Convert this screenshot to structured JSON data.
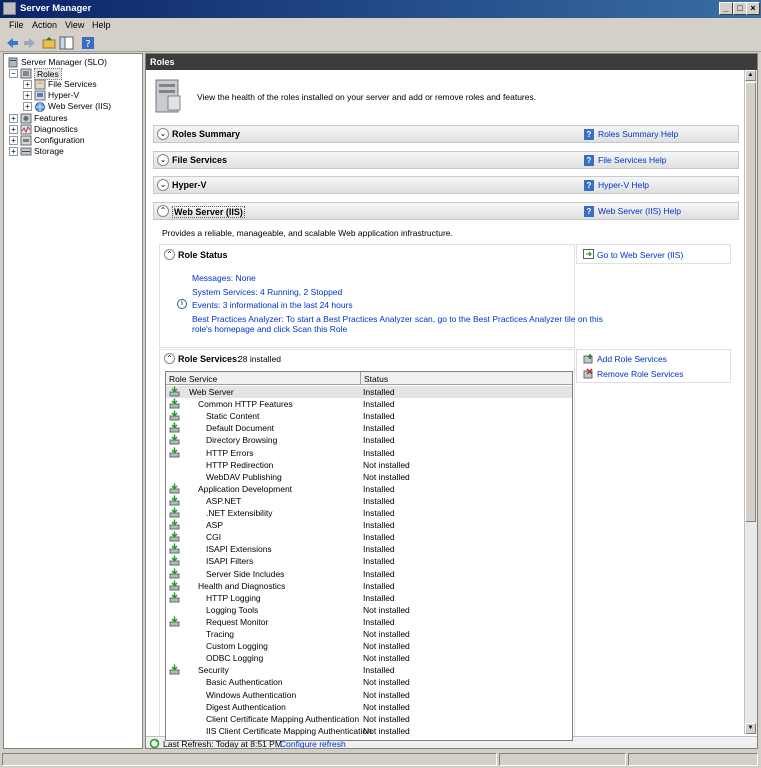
{
  "window": {
    "title": "Server Manager"
  },
  "menu": [
    "File",
    "Action",
    "View",
    "Help"
  ],
  "tree": {
    "root": "Server Manager (SLO)",
    "items": [
      {
        "label": "Roles",
        "level": 1
      },
      {
        "label": "File Services",
        "level": 2
      },
      {
        "label": "Hyper-V",
        "level": 2
      },
      {
        "label": "Web Server (IIS)",
        "level": 2
      },
      {
        "label": "Features",
        "level": 1
      },
      {
        "label": "Diagnostics",
        "level": 1
      },
      {
        "label": "Configuration",
        "level": 1
      },
      {
        "label": "Storage",
        "level": 1
      }
    ]
  },
  "main": {
    "header": "Roles",
    "intro": "View the health of the roles installed on your server and add or remove roles and features.",
    "sections": [
      {
        "title": "Roles Summary",
        "help": "Roles Summary Help"
      },
      {
        "title": "File Services",
        "help": "File Services Help"
      },
      {
        "title": "Hyper-V",
        "help": "Hyper-V Help"
      },
      {
        "title": "Web Server (IIS)",
        "help": "Web Server (IIS) Help"
      }
    ],
    "iis_description": "Provides a reliable, manageable, and scalable Web application infrastructure.",
    "role_status": {
      "title": "Role Status",
      "goto": "Go to Web Server (IIS)",
      "messages": "Messages: None",
      "services": "System Services: 4 Running, 2 Stopped",
      "events": "Events: 3 informational in the last 24 hours",
      "bpa_line1": "Best Practices Analyzer: To start a Best Practices Analyzer scan, go to the Best Practices Analyzer tile on this",
      "bpa_line2": "role's homepage and click Scan this Role"
    },
    "role_services": {
      "title": "Role Services:",
      "count": "28 installed",
      "add": "Add Role Services",
      "remove": "Remove Role Services",
      "col_service": "Role Service",
      "col_status": "Status",
      "rows": [
        {
          "name": "Web Server",
          "level": 0,
          "status": "Installed",
          "icon": true
        },
        {
          "name": "Common HTTP Features",
          "level": 1,
          "status": "Installed",
          "icon": true
        },
        {
          "name": "Static Content",
          "level": 2,
          "status": "Installed",
          "icon": true
        },
        {
          "name": "Default Document",
          "level": 2,
          "status": "Installed",
          "icon": true
        },
        {
          "name": "Directory Browsing",
          "level": 2,
          "status": "Installed",
          "icon": true
        },
        {
          "name": "HTTP Errors",
          "level": 2,
          "status": "Installed",
          "icon": true
        },
        {
          "name": "HTTP Redirection",
          "level": 2,
          "status": "Not installed",
          "icon": false
        },
        {
          "name": "WebDAV Publishing",
          "level": 2,
          "status": "Not installed",
          "icon": false
        },
        {
          "name": "Application Development",
          "level": 1,
          "status": "Installed",
          "icon": true
        },
        {
          "name": "ASP.NET",
          "level": 2,
          "status": "Installed",
          "icon": true
        },
        {
          "name": ".NET Extensibility",
          "level": 2,
          "status": "Installed",
          "icon": true
        },
        {
          "name": "ASP",
          "level": 2,
          "status": "Installed",
          "icon": true
        },
        {
          "name": "CGI",
          "level": 2,
          "status": "Installed",
          "icon": true
        },
        {
          "name": "ISAPI Extensions",
          "level": 2,
          "status": "Installed",
          "icon": true
        },
        {
          "name": "ISAPI Filters",
          "level": 2,
          "status": "Installed",
          "icon": true
        },
        {
          "name": "Server Side Includes",
          "level": 2,
          "status": "Installed",
          "icon": true
        },
        {
          "name": "Health and Diagnostics",
          "level": 1,
          "status": "Installed",
          "icon": true
        },
        {
          "name": "HTTP Logging",
          "level": 2,
          "status": "Installed",
          "icon": true
        },
        {
          "name": "Logging Tools",
          "level": 2,
          "status": "Not installed",
          "icon": false
        },
        {
          "name": "Request Monitor",
          "level": 2,
          "status": "Installed",
          "icon": true
        },
        {
          "name": "Tracing",
          "level": 2,
          "status": "Not installed",
          "icon": false
        },
        {
          "name": "Custom Logging",
          "level": 2,
          "status": "Not installed",
          "icon": false
        },
        {
          "name": "ODBC Logging",
          "level": 2,
          "status": "Not installed",
          "icon": false
        },
        {
          "name": "Security",
          "level": 1,
          "status": "Installed",
          "icon": true
        },
        {
          "name": "Basic Authentication",
          "level": 2,
          "status": "Not installed",
          "icon": false
        },
        {
          "name": "Windows Authentication",
          "level": 2,
          "status": "Not installed",
          "icon": false
        },
        {
          "name": "Digest Authentication",
          "level": 2,
          "status": "Not installed",
          "icon": false
        },
        {
          "name": "Client Certificate Mapping Authentication",
          "level": 2,
          "status": "Not installed",
          "icon": false
        },
        {
          "name": "IIS Client Certificate Mapping Authentication",
          "level": 2,
          "status": "Not installed",
          "icon": false
        }
      ]
    },
    "refresh": {
      "text": "Last Refresh: Today at 8:51 PM",
      "configure": "Configure refresh"
    }
  }
}
